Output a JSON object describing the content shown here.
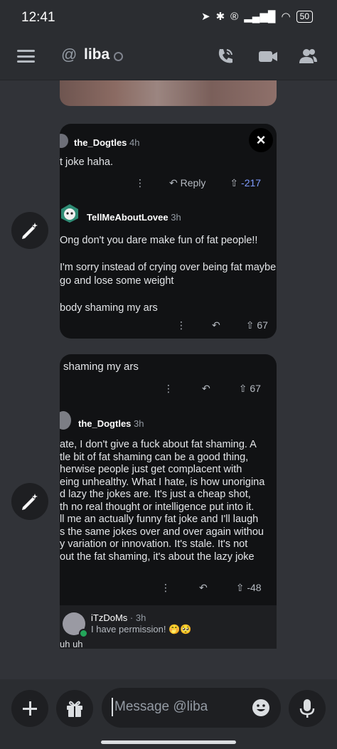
{
  "status": {
    "time": "12:41",
    "battery": "50"
  },
  "header": {
    "at_symbol": "@",
    "name": "liba"
  },
  "card1": {
    "comment_a": {
      "author": "the_Dogtles",
      "time": "4h",
      "text": "t joke haha.",
      "reply": "Reply",
      "votes": "-217"
    },
    "comment_b": {
      "author": "TellMeAboutLovee",
      "time": "3h",
      "text": "Ong don't you dare make fun of fat people!!\n\nI'm sorry instead of crying over being fat maybe\ngo and lose some weight\n\nbody shaming my ars",
      "votes": "67"
    }
  },
  "card2": {
    "quote_text": "shaming my ars",
    "quote_votes": "67",
    "comment": {
      "author": "the_Dogtles",
      "time": "3h",
      "text": "ate, I don't give a fuck about fat shaming. A\ntle bit of fat shaming can be a good thing,\nherwise people just get complacent with\neing unhealthy. What I hate, is how unorigina\nd lazy the jokes are. It's just a cheap shot,\nth no real thought or intelligence put into it.\nll me an actually funny fat joke and I'll laugh\ns the same jokes over and over again withou\ny variation or innovation. It's stale. It's not\nout the fat shaming, it's about the lazy joke",
      "votes": "-48"
    },
    "reply": {
      "author": "iTzDoMs",
      "time": "· 3h",
      "text": "I have permission! 🤭🥺",
      "sub": "uh uh"
    }
  },
  "close_label": "×",
  "input": {
    "placeholder": "Message @liba"
  },
  "icons": [
    "hamburger-icon",
    "call-icon",
    "video-icon",
    "members-icon",
    "edit-sparkle-icon",
    "plus-icon",
    "gift-icon",
    "emoji-icon",
    "mic-icon",
    "kebab-icon",
    "reply-arrow-icon",
    "upvote-icon",
    "close-icon"
  ]
}
